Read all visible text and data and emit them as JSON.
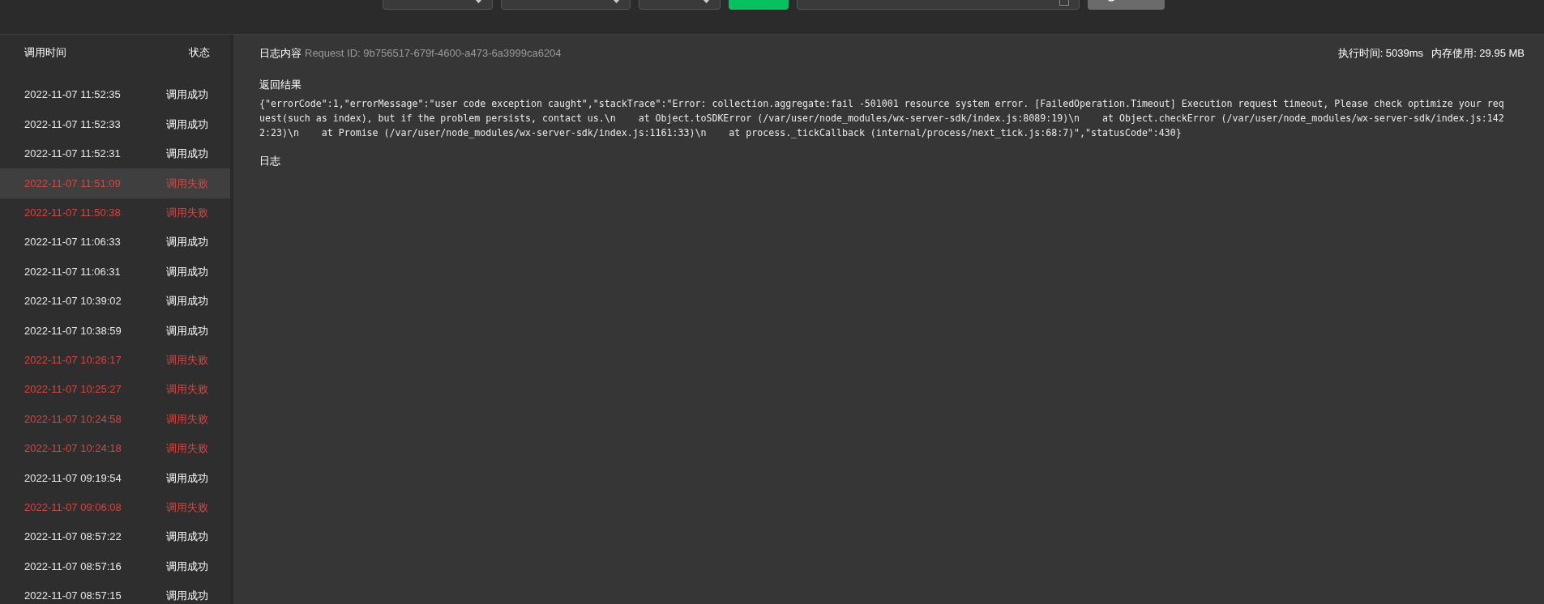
{
  "list": {
    "columns": [
      "调用时间",
      "状态"
    ],
    "rows": [
      {
        "time": "2022-11-07 11:52:35",
        "status": "调用成功",
        "failed": false,
        "selected": false
      },
      {
        "time": "2022-11-07 11:52:33",
        "status": "调用成功",
        "failed": false,
        "selected": false
      },
      {
        "time": "2022-11-07 11:52:31",
        "status": "调用成功",
        "failed": false,
        "selected": false
      },
      {
        "time": "2022-11-07 11:51:09",
        "status": "调用失败",
        "failed": true,
        "selected": true
      },
      {
        "time": "2022-11-07 11:50:38",
        "status": "调用失败",
        "failed": true,
        "selected": false
      },
      {
        "time": "2022-11-07 11:06:33",
        "status": "调用成功",
        "failed": false,
        "selected": false
      },
      {
        "time": "2022-11-07 11:06:31",
        "status": "调用成功",
        "failed": false,
        "selected": false
      },
      {
        "time": "2022-11-07 10:39:02",
        "status": "调用成功",
        "failed": false,
        "selected": false
      },
      {
        "time": "2022-11-07 10:38:59",
        "status": "调用成功",
        "failed": false,
        "selected": false
      },
      {
        "time": "2022-11-07 10:26:17",
        "status": "调用失败",
        "failed": true,
        "selected": false
      },
      {
        "time": "2022-11-07 10:25:27",
        "status": "调用失败",
        "failed": true,
        "selected": false
      },
      {
        "time": "2022-11-07 10:24:58",
        "status": "调用失败",
        "failed": true,
        "selected": false
      },
      {
        "time": "2022-11-07 10:24:18",
        "status": "调用失败",
        "failed": true,
        "selected": false
      },
      {
        "time": "2022-11-07 09:19:54",
        "status": "调用成功",
        "failed": false,
        "selected": false
      },
      {
        "time": "2022-11-07 09:06:08",
        "status": "调用失败",
        "failed": true,
        "selected": false
      },
      {
        "time": "2022-11-07 08:57:22",
        "status": "调用成功",
        "failed": false,
        "selected": false
      },
      {
        "time": "2022-11-07 08:57:16",
        "status": "调用成功",
        "failed": false,
        "selected": false
      },
      {
        "time": "2022-11-07 08:57:15",
        "status": "调用成功",
        "failed": false,
        "selected": false
      }
    ]
  },
  "log": {
    "title": "日志内容",
    "request_id": "Request ID: 9b756517-679f-4600-a473-6a3999ca6204",
    "exec_time": "执行时间: 5039ms",
    "memory": "内存使用: 29.95 MB",
    "result_heading": "返回结果",
    "result": "{\"errorCode\":1,\"errorMessage\":\"user code exception caught\",\"stackTrace\":\"Error: collection.aggregate:fail -501001 resource system error. [FailedOperation.Timeout] Execution request timeout, Please check optimize your request(such as index), but if the problem persists, contact us.\\n    at Object.toSDKError (/var/user/node_modules/wx-server-sdk/index.js:8089:19)\\n    at Object.checkError (/var/user/node_modules/wx-server-sdk/index.js:1422:23)\\n    at Promise (/var/user/node_modules/wx-server-sdk/index.js:1161:33)\\n    at process._tickCallback (internal/process/next_tick.js:68:7)\",\"statusCode\":430}",
    "log_heading": "日志"
  }
}
